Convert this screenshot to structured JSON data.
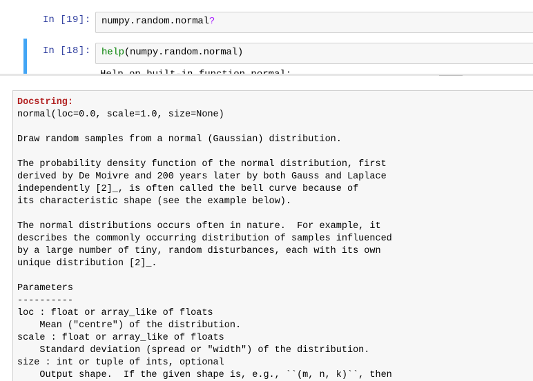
{
  "cells": [
    {
      "prompt_label": "In",
      "prompt_num": "[19]:",
      "code_prefix": "numpy.random.normal",
      "code_suffix": "?"
    },
    {
      "prompt_label": "In",
      "prompt_num": "[18]:",
      "code_keyword": "help",
      "code_rest": "(numpy.random.normal)",
      "partial_output": "Help on built-in function normal:"
    }
  ],
  "pager": {
    "header": "Docstring:",
    "lines": [
      "normal(loc=0.0, scale=1.0, size=None)",
      "",
      "Draw random samples from a normal (Gaussian) distribution.",
      "",
      "The probability density function of the normal distribution, first",
      "derived by De Moivre and 200 years later by both Gauss and Laplace",
      "independently [2]_, is often called the bell curve because of",
      "its characteristic shape (see the example below).",
      "",
      "The normal distributions occurs often in nature.  For example, it",
      "describes the commonly occurring distribution of samples influenced",
      "by a large number of tiny, random disturbances, each with its own",
      "unique distribution [2]_.",
      "",
      "Parameters",
      "----------",
      "loc : float or array_like of floats",
      "    Mean (\"centre\") of the distribution.",
      "scale : float or array_like of floats",
      "    Standard deviation (spread or \"width\") of the distribution.",
      "size : int or tuple of ints, optional",
      "    Output shape.  If the given shape is, e.g., ``(m, n, k)``, then"
    ]
  },
  "colors": {
    "prompt": "#303f9f",
    "selected_bar": "#42a5f5",
    "docstring_header": "#b22222",
    "help_keyword": "#008000",
    "question_mark": "#aa22ff"
  }
}
